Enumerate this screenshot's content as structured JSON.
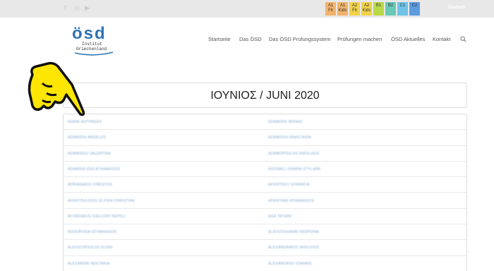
{
  "topbar": {
    "social": [
      "f",
      "◎",
      "▶"
    ],
    "levels": [
      {
        "code": "A1",
        "sub": "Fit",
        "color": "#f2b36b"
      },
      {
        "code": "A1",
        "sub": "Kids",
        "color": "#f2b36b"
      },
      {
        "code": "A2",
        "sub": "Fit",
        "color": "#f0d24a"
      },
      {
        "code": "A2",
        "sub": "Kids",
        "color": "#f0d24a"
      },
      {
        "code": "B1",
        "sub": "",
        "color": "#b8d948"
      },
      {
        "code": "B2",
        "sub": "",
        "color": "#69c8b8"
      },
      {
        "code": "C1",
        "sub": "",
        "color": "#6fc3e8"
      },
      {
        "code": "C2",
        "sub": "",
        "color": "#5c9be0"
      }
    ],
    "language": "Deutsch"
  },
  "logo": {
    "word": "ösd",
    "line1": "Institut",
    "line2": "Griechenland"
  },
  "nav": {
    "items": [
      "Startseite",
      "Das ÖSD",
      "Das ÖSD Prüfungssystem",
      "Prüfungen machen",
      "ÖSD Aktuelles",
      "Kontakt"
    ]
  },
  "page": {
    "title": "ΙΟΥΝΙΟΣ / JUNI 2020"
  },
  "table": {
    "rows": [
      [
        "ADAMI ASTHREES",
        "ADAMIDIS SKRAIS"
      ],
      [
        "ADAMIDIS ANGELOS",
        "ADAMIDOU ANASTASIA"
      ],
      [
        "ADAMIDOU VALENTINA",
        "ADAMOPOULOS NIKOLAOS"
      ],
      [
        "ADAMOULIDIS ATHANASIOS",
        "ADDINALI IOANNA STYLIANI"
      ],
      [
        "ADRIANAKIS CHRISTOS",
        "AFENTOULI STAMATIA"
      ],
      [
        "AFENTOULIDOU ELPIDA CHRISTINA",
        "AFENTRAS ATHANASIOS"
      ],
      [
        "AFORDAKOU KALLIOPI NEPELI",
        "AGA TATIANI"
      ],
      [
        "AGOUROSAI ATHANASIOS",
        "ALEVIZOGIANNI DESPOINA"
      ],
      [
        "ALEVIZOPOULOU ELENI",
        "ALEXANDRAKIS VASILEIOS"
      ],
      [
        "ALEXANDRI NEKTARIA",
        "ALEXANDROU IOANNIS"
      ]
    ]
  }
}
